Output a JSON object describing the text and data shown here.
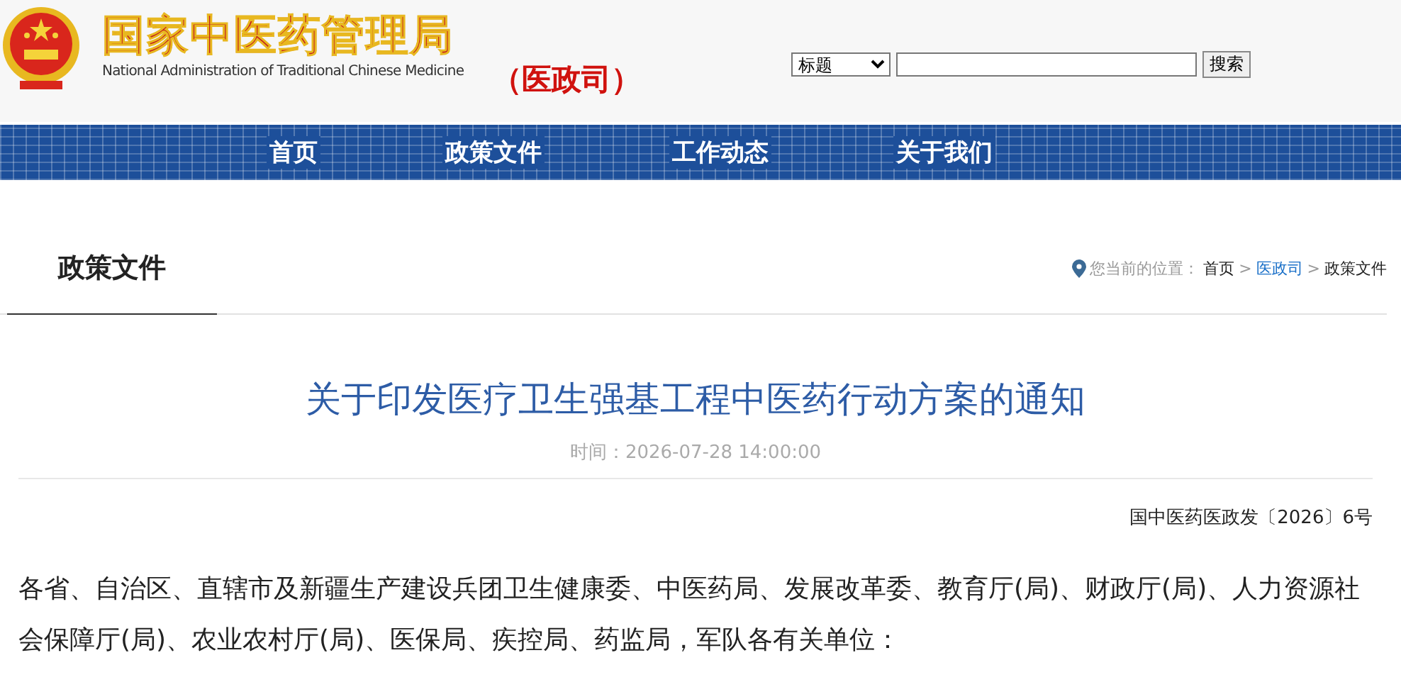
{
  "header": {
    "agency_name": "国家中医药管理局",
    "agency_name_en": "National Administration of Traditional Chinese Medicine",
    "department": "（医政司）"
  },
  "search": {
    "scope": "标题",
    "button": "搜索"
  },
  "nav": [
    {
      "label": "首页"
    },
    {
      "label": "政策文件"
    },
    {
      "label": "工作动态"
    },
    {
      "label": "关于我们"
    }
  ],
  "section_title": "政策文件",
  "breadcrumb": {
    "prefix": "您当前的位置：",
    "separator": ">",
    "items": [
      {
        "label": "首页",
        "highlighted": false
      },
      {
        "label": "医政司",
        "highlighted": true
      },
      {
        "label": "政策文件",
        "highlighted": false
      }
    ]
  },
  "article": {
    "title": "关于印发医疗卫生强基工程中医药行动方案的通知",
    "time": "时间：2026-07-28 14:00:00",
    "doc_number": "国中医药医政发〔2026〕6号",
    "body": "各省、自治区、直辖市及新疆生产建设兵团卫生健康委、中医药局、发展改革委、教育厅(局)、财政厅(局)、人力资源社会保障厅(局)、农业农村厅(局)、医保局、疾控局、药监局，军队各有关单位："
  }
}
